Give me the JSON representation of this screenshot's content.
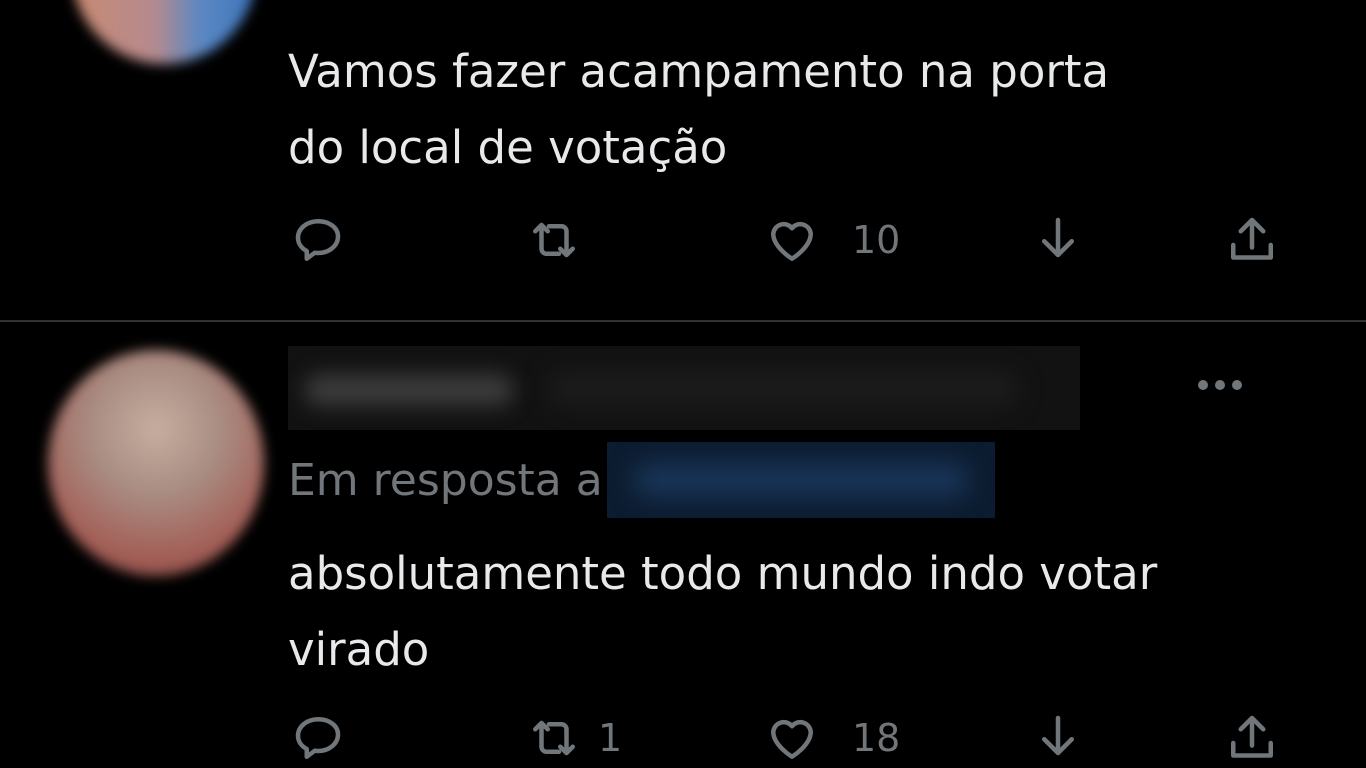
{
  "theme": {
    "background": "#000000",
    "text_primary": "#e7e9ea",
    "text_secondary": "#71767b",
    "divider": "#2f3336",
    "mention_redaction": "#0c1c30"
  },
  "tweets": [
    {
      "text_lines": [
        "Vamos fazer acampamento na porta",
        "do local de votação"
      ],
      "actions": {
        "reply": {
          "icon": "comment-icon",
          "count": ""
        },
        "retweet": {
          "icon": "retweet-icon",
          "count": ""
        },
        "like": {
          "icon": "heart-icon",
          "count": "10"
        },
        "bookmark": {
          "icon": "download-arrow-icon"
        },
        "share": {
          "icon": "share-icon"
        }
      }
    },
    {
      "reply_context_label": "Em resposta a",
      "text_lines": [
        "absolutamente todo mundo indo votar",
        "virado"
      ],
      "actions": {
        "reply": {
          "icon": "comment-icon",
          "count": ""
        },
        "retweet": {
          "icon": "retweet-icon",
          "count": "1"
        },
        "like": {
          "icon": "heart-icon",
          "count": "18"
        },
        "bookmark": {
          "icon": "download-arrow-icon"
        },
        "share": {
          "icon": "share-icon"
        }
      }
    }
  ]
}
